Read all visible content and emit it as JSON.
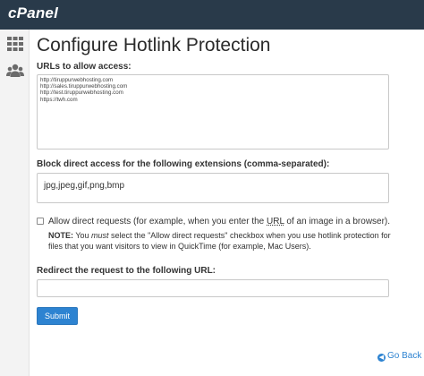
{
  "app": {
    "logo_text": "cPanel"
  },
  "sidebar": {
    "items": [
      {
        "icon": "grid-icon"
      },
      {
        "icon": "users-icon"
      }
    ]
  },
  "page": {
    "title": "Configure Hotlink Protection"
  },
  "urls_section": {
    "label": "URLs to allow access:",
    "value": "http://tiruppurwebhosting.com\nhttp://sales.tiruppurwebhosting.com\nhttp://test.tiruppurwebhosting.com\nhttps://twh.com"
  },
  "extensions_section": {
    "label": "Block direct access for the following extensions (comma-separated):",
    "value": "jpg,jpeg,gif,png,bmp"
  },
  "allow_direct": {
    "checked": false,
    "label_before": "Allow direct requests (for example, when you enter the ",
    "label_url": "URL",
    "label_after": " of an image in a browser)."
  },
  "note": {
    "prefix": "NOTE:",
    "text_1": " You ",
    "emph": "must",
    "text_2": " select the \"Allow direct requests\" checkbox when you use hotlink protection for files that you want visitors to view in QuickTime (for example, Mac Users)."
  },
  "redirect_section": {
    "label": "Redirect the request to the following URL:",
    "value": "",
    "placeholder": ""
  },
  "actions": {
    "submit_label": "Submit",
    "go_back_label": "Go Back"
  },
  "colors": {
    "topbar": "#293a4a",
    "primary": "#2d83d1"
  }
}
